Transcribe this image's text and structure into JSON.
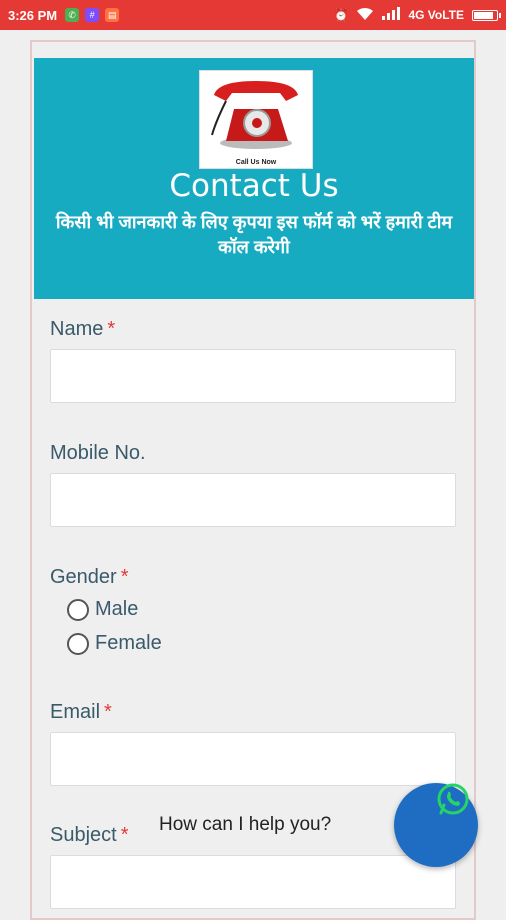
{
  "status_bar": {
    "time": "3:26 PM",
    "network": "4G VoLTE"
  },
  "header": {
    "logo_caption": "Call Us Now",
    "title": "Contact Us",
    "subtitle": "किसी भी जानकारी के लिए कृपया इस फॉर्म को भरें हमारी टीम कॉल करेगी"
  },
  "form": {
    "name_label": "Name",
    "mobile_label": "Mobile No.",
    "gender_label": "Gender",
    "gender_options": [
      "Male",
      "Female"
    ],
    "email_label": "Email",
    "subject_label": "Subject",
    "required_mark": "*"
  },
  "chat": {
    "prompt": "How can I help you?"
  },
  "colors": {
    "status_bar": "#e53935",
    "header_bg": "#17abc2",
    "chat_button": "#1f6dc2",
    "required": "#e53935"
  }
}
